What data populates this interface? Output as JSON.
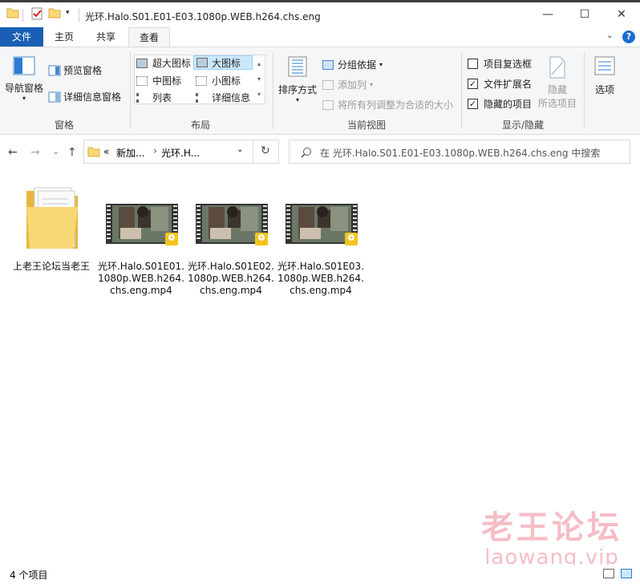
{
  "window": {
    "title": "光环.Halo.S01.E01-E03.1080p.WEB.h264.chs.eng",
    "minimize_glyph": "—",
    "maximize_glyph": "☐",
    "close_glyph": "✕"
  },
  "tabs": [
    "文件",
    "主页",
    "共享",
    "查看"
  ],
  "ribbon": {
    "panes": {
      "nav_pane": "导航窗格",
      "preview_pane": "预览窗格",
      "details_pane": "详细信息窗格",
      "label": "窗格"
    },
    "layout": {
      "items": [
        "超大图标",
        "大图标",
        "中图标",
        "小图标",
        "列表",
        "详细信息"
      ],
      "selected": "大图标",
      "label": "布局"
    },
    "current_view": {
      "sort": "排序方式",
      "group_by": "分组依据",
      "add_column": "添加列",
      "fit_columns": "将所有列调整为合适的大小",
      "label": "当前视图"
    },
    "show_hide": {
      "item_checkboxes": "项目复选框",
      "item_checkboxes_checked": false,
      "file_extensions": "文件扩展名",
      "file_extensions_checked": true,
      "hidden_items": "隐藏的项目",
      "hidden_items_checked": true,
      "hide_selected_line1": "隐藏",
      "hide_selected_line2": "所选项目",
      "label": "显示/隐藏"
    },
    "options": "选项"
  },
  "address": {
    "chevron": "«",
    "crumbs": [
      "新加...",
      "光环.H..."
    ],
    "search_placeholder": "在 光环.Halo.S01.E01-E03.1080p.WEB.h264.chs.eng 中搜索"
  },
  "files": [
    {
      "name": "上老王论坛当老王",
      "type": "folder"
    },
    {
      "name": "光环.Halo.S01E01.1080p.WEB.h264.chs.eng.mp4",
      "type": "video"
    },
    {
      "name": "光环.Halo.S01E02.1080p.WEB.h264.chs.eng.mp4",
      "type": "video"
    },
    {
      "name": "光环.Halo.S01E03.1080p.WEB.h264.chs.eng.mp4",
      "type": "video"
    }
  ],
  "player_badge": "Player",
  "status": {
    "count": "4 个项目"
  },
  "watermark": {
    "line1": "老王论坛",
    "line2": "laowang.vip"
  },
  "colors": {
    "accent": "#1a5fb4",
    "folder": "#f8d775",
    "watermark": "#e85266"
  }
}
